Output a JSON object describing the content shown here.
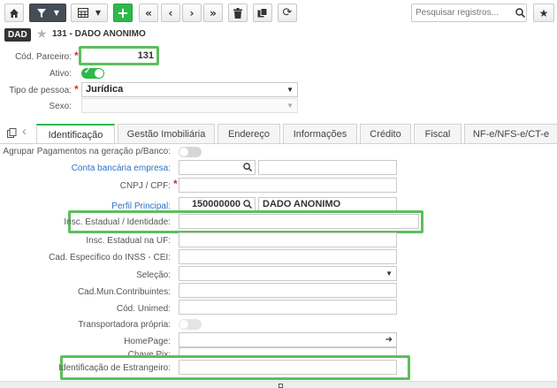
{
  "toolbar": {
    "search_placeholder": "Pesquisar registros..."
  },
  "record": {
    "badge": "DAD",
    "title": "131 - DADO ANONIMO"
  },
  "header_form": {
    "cod_parceiro_label": "Cód. Parceiro:",
    "cod_parceiro_value": "131",
    "ativo_label": "Ativo:",
    "tipo_pessoa_label": "Tipo de pessoa:",
    "tipo_pessoa_value": "Jurídica",
    "sexo_label": "Sexo:"
  },
  "tabs": [
    {
      "label": "Identificação"
    },
    {
      "label": "Gestão Imobiliária"
    },
    {
      "label": "Endereço"
    },
    {
      "label": "Informações"
    },
    {
      "label": "Crédito"
    },
    {
      "label": "Fiscal"
    },
    {
      "label": "NF-e/NFS-e/CT-e"
    }
  ],
  "form": {
    "agrupar_label": "Agrupar Pagamentos na geração p/Banco:",
    "conta_bancaria_label": "Conta bancária empresa:",
    "cnpj_label": "CNPJ / CPF:",
    "perfil_label": "Perfil Principal:",
    "perfil_code": "150000000",
    "perfil_name": "DADO ANONIMO",
    "insc_estadual_label": "Insc. Estadual / Identidade:",
    "insc_uf_label": "Insc. Estadual na UF:",
    "cad_inss_label": "Cad. Especifico do INSS - CEI:",
    "selecao_label": "Seleção:",
    "cad_mun_label": "Cad.Mun.Contribuintes:",
    "cod_unimed_label": "Cód. Unimed:",
    "transportadora_label": "Transportadora própria:",
    "homepage_label": "HomePage:",
    "chave_pix_label": "Chave Pix:",
    "estrangeiro_label": "Identificação de Estrangeiro:"
  },
  "colors": {
    "accent_green": "#2eb94a",
    "toolbar_dark": "#454e57",
    "highlight": "#5cbf5c",
    "link_blue": "#2b72c8"
  }
}
